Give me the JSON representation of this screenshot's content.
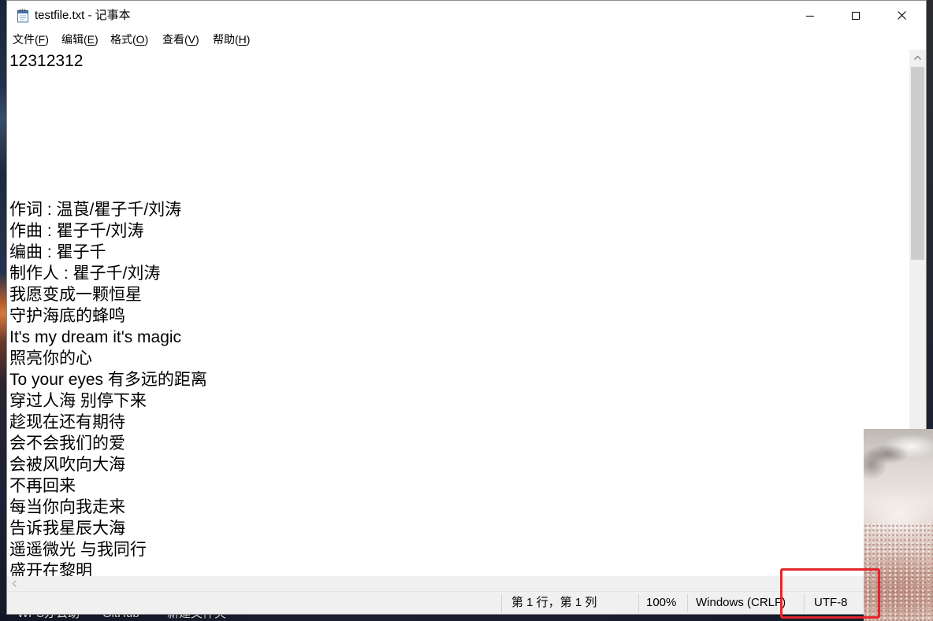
{
  "title_bar": {
    "app_icon": "notepad-icon",
    "title": "testfile.txt - 记事本",
    "buttons": {
      "minimize": "minimize-icon",
      "maximize": "maximize-icon",
      "close": "close-icon"
    }
  },
  "menu_bar": {
    "items": [
      {
        "pre": "文件(",
        "key": "F",
        "post": ")"
      },
      {
        "pre": "编辑(",
        "key": "E",
        "post": ")"
      },
      {
        "pre": "格式(",
        "key": "O",
        "post": ")"
      },
      {
        "pre": "查看(",
        "key": "V",
        "post": ")"
      },
      {
        "pre": "帮助(",
        "key": "H",
        "post": ")"
      }
    ]
  },
  "editor": {
    "lines": [
      "12312312",
      "",
      "",
      "",
      "",
      "",
      "",
      "作词 : 温莨/瞿子千/刘涛",
      "作曲 : 瞿子千/刘涛",
      "编曲 : 瞿子千",
      "制作人 : 瞿子千/刘涛",
      "我愿变成一颗恒星",
      "守护海底的蜂鸣",
      "It's my dream it's magic",
      "照亮你的心",
      "To your eyes 有多远的距离",
      "穿过人海 别停下来",
      "趁现在还有期待",
      "会不会我们的爱",
      "会被风吹向大海",
      "不再回来",
      "每当你向我走来",
      "告诉我星辰大海",
      "遥遥微光 与我同行",
      "盛开在黎明"
    ]
  },
  "scrollbars": {
    "up_arrow": "chevron-up-icon",
    "left_arrow": "chevron-left-icon"
  },
  "status_bar": {
    "cursor_position": "第 1 行，第 1 列",
    "zoom": "100%",
    "line_ending": "Windows (CRLF)",
    "encoding": "UTF-8"
  },
  "desktop": {
    "icon_labels": [
      "WPS办公助",
      "GitHub",
      "新建文件夹"
    ]
  },
  "annotation": {
    "highlight_color": "#e3262b"
  }
}
